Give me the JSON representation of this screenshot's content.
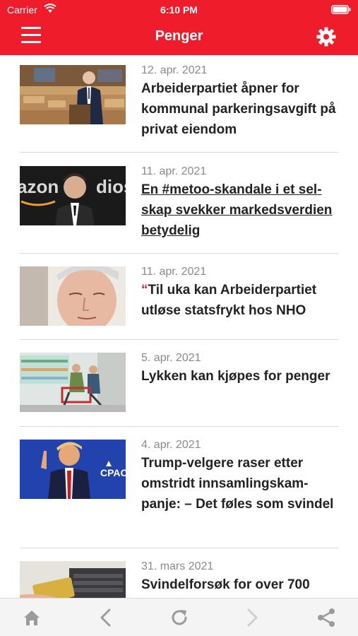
{
  "status": {
    "carrier": "Carrier",
    "time": "6:10 PM"
  },
  "nav": {
    "title": "Penger"
  },
  "colors": {
    "brand": "#ef1c2b",
    "date": "#8a8a8a",
    "title": "#222222",
    "toolbar_icon": "#9b9b9b",
    "toolbar_icon_disabled": "#cfcfcf"
  },
  "articles": [
    {
      "date": "12. apr. 2021",
      "title": "Arbeiderpartiet åpner for kommunal parkeringsavgift på privat eiendom",
      "image": "parliament-speaker-photo"
    },
    {
      "date": "11. apr. 2021",
      "title": "En #metoo-skandale i et sel­skap svekker markedsverdi­en betydelig",
      "image": "man-in-front-of-amazon-studios-sign-photo"
    },
    {
      "date": "11. apr. 2021",
      "quote": "“",
      "title": "Til uka kan Arbeiderpartiet utløse statsfrykt hos NHO",
      "image": "politician-closeup-photo"
    },
    {
      "date": "5. apr. 2021",
      "title": "Lykken kan kjøpes for pen­ger",
      "image": "supermarket-shoppers-photo"
    },
    {
      "date": "4. apr. 2021",
      "title": "Trump-velgere raser etter omstridt innsamlingskam­panje: – Det føles som svin­del",
      "image": "trump-cpac-photo"
    },
    {
      "date": "31. mars 2021",
      "title": "Svindelforsøk for over 700",
      "image": "card-on-laptop-photo"
    }
  ],
  "toolbar": {
    "icons": [
      "home-icon",
      "back-icon",
      "refresh-icon",
      "forward-icon",
      "share-icon"
    ]
  }
}
